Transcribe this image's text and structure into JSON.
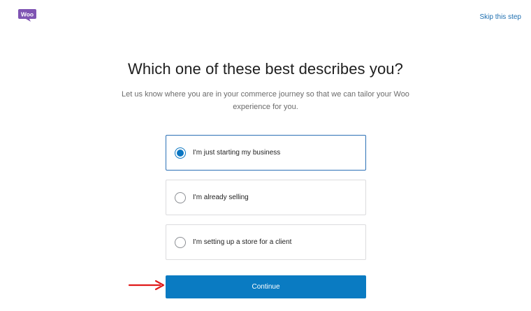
{
  "header": {
    "logo_text": "Woo",
    "skip_label": "Skip this step"
  },
  "main": {
    "title": "Which one of these best describes you?",
    "subtitle": "Let us know where you are in your commerce journey so that we can tailor your Woo experience for you.",
    "options": [
      {
        "label": "I'm just starting my business",
        "selected": true
      },
      {
        "label": "I'm already selling",
        "selected": false
      },
      {
        "label": "I'm setting up a store for a client",
        "selected": false
      }
    ],
    "continue_label": "Continue"
  },
  "icons": {
    "logo": "woo-logo-icon",
    "annotation": "red-arrow-icon"
  },
  "colors": {
    "brand": "#7f54b3",
    "accent": "#0a7bc2",
    "link": "#1e6fb0",
    "annotation": "#e01b1b"
  }
}
